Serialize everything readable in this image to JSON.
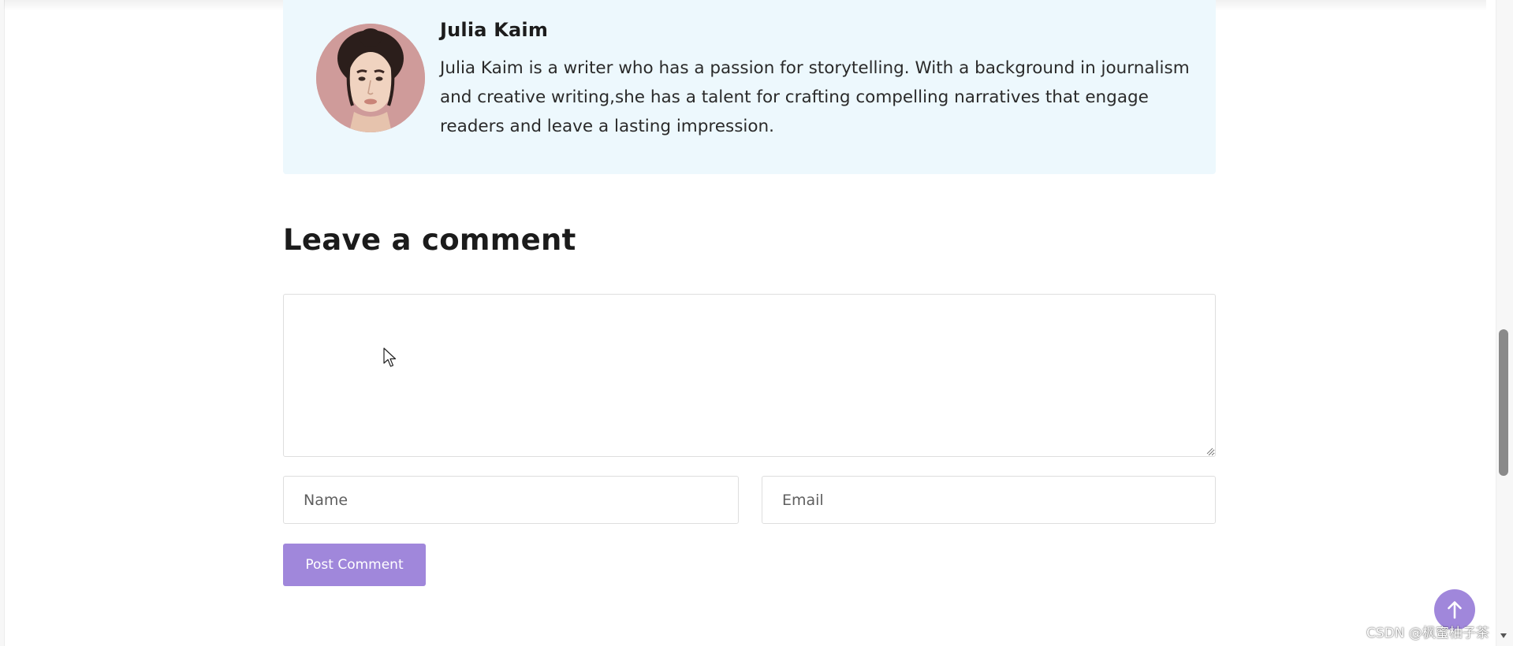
{
  "author": {
    "name": "Julia Kaim",
    "bio": "Julia Kaim is a writer who has a passion for storytelling. With a background in journalism and creative writing,she has a talent for crafting compelling narratives that engage readers and leave a lasting impression.",
    "box_background": "#edf8fd"
  },
  "comment_form": {
    "heading": "Leave a comment",
    "comment_value": "",
    "name_placeholder": "Name",
    "email_placeholder": "Email",
    "submit_label": "Post Comment",
    "accent_color": "#a087db"
  },
  "back_to_top": {
    "icon": "arrow-up-icon"
  },
  "watermark": "CSDN @枫蜜柚子茶"
}
